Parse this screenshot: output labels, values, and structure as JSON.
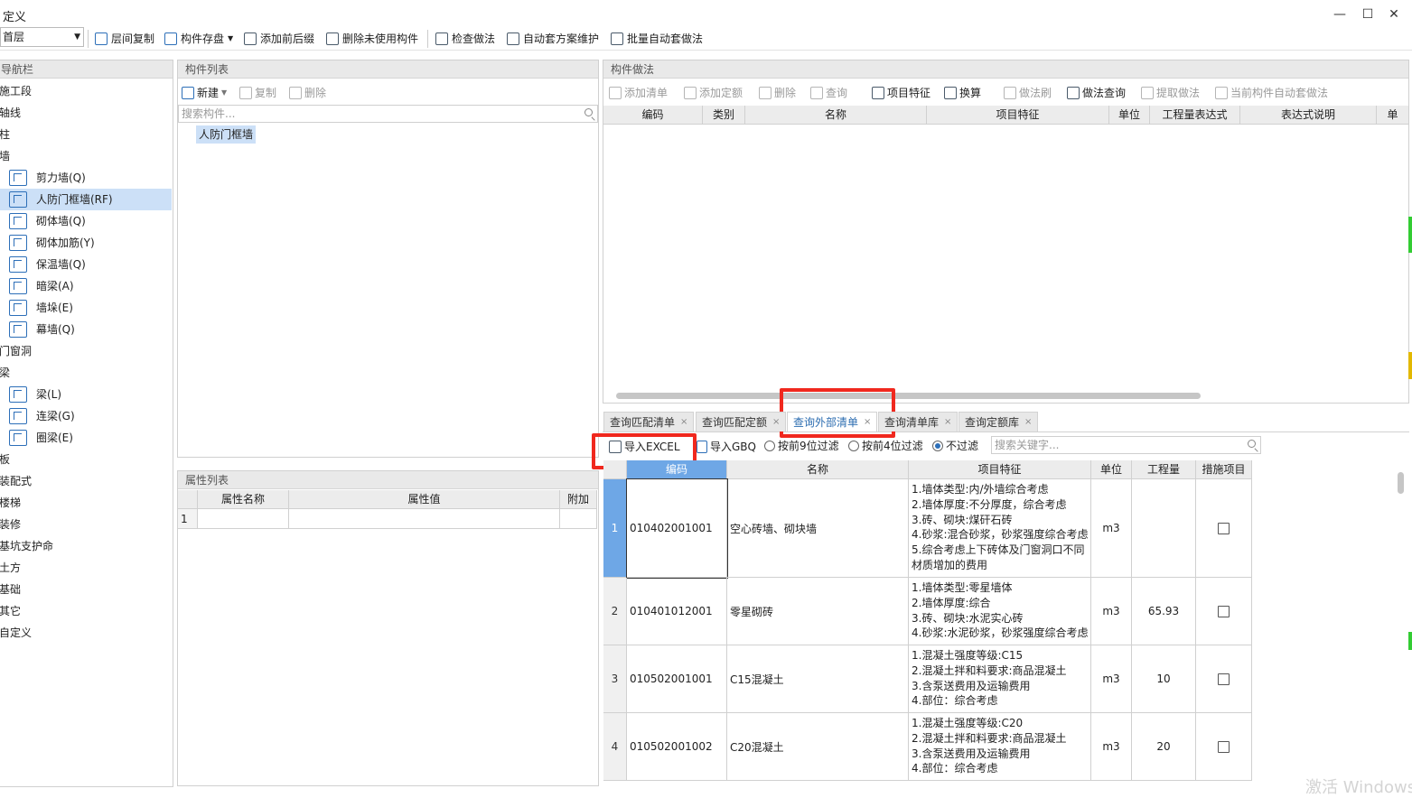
{
  "window": {
    "title": "定义",
    "min": "—",
    "max": "☐",
    "close": "✕"
  },
  "toolbar": {
    "floor": "首层",
    "buttons": [
      "层间复制",
      "构件存盘",
      "添加前后缀",
      "删除未使用构件",
      "检查做法",
      "自动套方案维护",
      "批量自动套做法"
    ]
  },
  "nav": {
    "header": "导航栏",
    "items": [
      {
        "label": "施工段",
        "sub": false
      },
      {
        "label": "轴线",
        "sub": false
      },
      {
        "label": "柱",
        "sub": false
      },
      {
        "label": "墙",
        "sub": false
      },
      {
        "label": "剪力墙(Q)",
        "sub": true,
        "icon": "shear-wall-icon"
      },
      {
        "label": "人防门框墙(RF)",
        "sub": true,
        "icon": "civil-defense-wall-icon",
        "selected": true
      },
      {
        "label": "砌体墙(Q)",
        "sub": true,
        "icon": "masonry-wall-icon"
      },
      {
        "label": "砌体加筋(Y)",
        "sub": true,
        "icon": "masonry-rebar-icon"
      },
      {
        "label": "保温墙(Q)",
        "sub": true,
        "icon": "insulation-wall-icon"
      },
      {
        "label": "暗梁(A)",
        "sub": true,
        "icon": "hidden-beam-icon"
      },
      {
        "label": "墙垛(E)",
        "sub": true,
        "icon": "wall-pier-icon"
      },
      {
        "label": "幕墙(Q)",
        "sub": true,
        "icon": "curtain-wall-icon"
      },
      {
        "label": "门窗洞",
        "sub": false
      },
      {
        "label": "梁",
        "sub": false
      },
      {
        "label": "梁(L)",
        "sub": true,
        "icon": "beam-icon"
      },
      {
        "label": "连梁(G)",
        "sub": true,
        "icon": "coupling-beam-icon"
      },
      {
        "label": "圈梁(E)",
        "sub": true,
        "icon": "ring-beam-icon"
      },
      {
        "label": "板",
        "sub": false
      },
      {
        "label": "装配式",
        "sub": false
      },
      {
        "label": "楼梯",
        "sub": false
      },
      {
        "label": "装修",
        "sub": false
      },
      {
        "label": "基坑支护命",
        "sub": false
      },
      {
        "label": "土方",
        "sub": false
      },
      {
        "label": "基础",
        "sub": false
      },
      {
        "label": "其它",
        "sub": false
      },
      {
        "label": "自定义",
        "sub": false
      }
    ]
  },
  "component_list": {
    "header": "构件列表",
    "new_label": "新建",
    "copy_label": "复制",
    "delete_label": "删除",
    "search_placeholder": "搜索构件...",
    "item": "人防门框墙"
  },
  "property_list": {
    "header": "属性列表",
    "columns": [
      "属性名称",
      "属性值",
      "附加"
    ],
    "row_no": "1"
  },
  "method_panel": {
    "header": "构件做法",
    "buttons": [
      "添加清单",
      "添加定额",
      "删除",
      "查询",
      "项目特征",
      "换算",
      "做法刷",
      "做法查询",
      "提取做法",
      "当前构件自动套做法"
    ],
    "columns": [
      "编码",
      "类别",
      "名称",
      "项目特征",
      "单位",
      "工程量表达式",
      "表达式说明",
      "单"
    ]
  },
  "query_tabs": [
    {
      "label": "查询匹配清单",
      "active": false
    },
    {
      "label": "查询匹配定额",
      "active": false
    },
    {
      "label": "查询外部清单",
      "active": true
    },
    {
      "label": "查询清单库",
      "active": false
    },
    {
      "label": "查询定额库",
      "active": false
    }
  ],
  "query_toolbar": {
    "import_excel": "导入EXCEL",
    "import_gbq": "导入GBQ",
    "filter9": "按前9位过滤",
    "filter4": "按前4位过滤",
    "nofilter": "不过滤",
    "search_placeholder": "搜索关键字..."
  },
  "query_table": {
    "columns": [
      "编码",
      "名称",
      "项目特征",
      "单位",
      "工程量",
      "措施项目"
    ],
    "rows": [
      {
        "no": "1",
        "code": "010402001001",
        "name": "空心砖墙、砌块墙",
        "feature": "1.墙体类型:内/外墙综合考虑\n2.墙体厚度:不分厚度，综合考虑\n3.砖、砌块:煤矸石砖\n4.砂浆:混合砂浆，砂浆强度综合考虑\n5.综合考虑上下砖体及门窗洞口不同\n材质增加的费用",
        "unit": "m3",
        "qty": ""
      },
      {
        "no": "2",
        "code": "010401012001",
        "name": "零星砌砖",
        "feature": "1.墙体类型:零星墙体\n2.墙体厚度:综合\n3.砖、砌块:水泥实心砖\n4.砂浆:水泥砂浆，砂浆强度综合考虑",
        "unit": "m3",
        "qty": "65.93"
      },
      {
        "no": "3",
        "code": "010502001001",
        "name": "C15混凝土",
        "feature": "1.混凝土强度等级:C15\n2.混凝土拌和料要求:商品混凝土\n3.含泵送费用及运输费用\n4.部位：综合考虑",
        "unit": "m3",
        "qty": "10"
      },
      {
        "no": "4",
        "code": "010502001002",
        "name": "C20混凝土",
        "feature": "1.混凝土强度等级:C20\n2.混凝土拌和料要求:商品混凝土\n3.含泵送费用及运输费用\n4.部位：综合考虑",
        "unit": "m3",
        "qty": "20"
      }
    ]
  },
  "watermark": "激活 Windows",
  "colors": {
    "accent": "#2d6fb8",
    "highlight": "#f0281e",
    "selection": "#cce0f7",
    "header_bg": "#e9e9e9"
  }
}
